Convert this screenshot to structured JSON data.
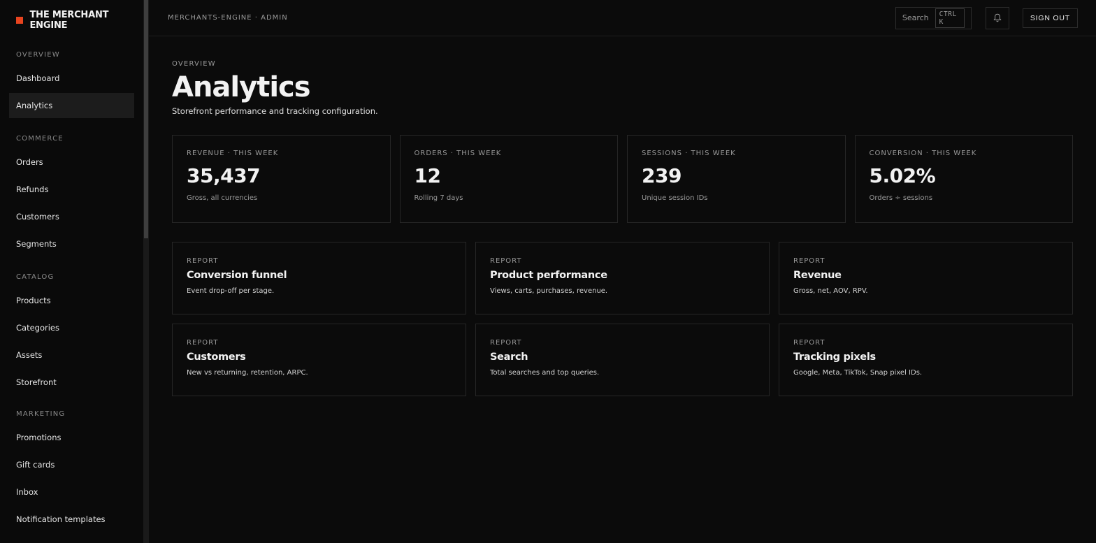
{
  "brand": {
    "name": "THE MERCHANT ENGINE",
    "accent": "#e8441f"
  },
  "sidebar": {
    "sections": [
      {
        "label": "OVERVIEW",
        "items": [
          "Dashboard",
          "Analytics"
        ]
      },
      {
        "label": "COMMERCE",
        "items": [
          "Orders",
          "Refunds",
          "Customers",
          "Segments"
        ]
      },
      {
        "label": "CATALOG",
        "items": [
          "Products",
          "Categories",
          "Assets",
          "Storefront"
        ]
      },
      {
        "label": "MARKETING",
        "items": [
          "Promotions",
          "Gift cards",
          "Inbox",
          "Notification templates"
        ]
      }
    ],
    "active_item": "Analytics"
  },
  "topbar": {
    "breadcrumb": "MERCHANTS-ENGINE · ADMIN",
    "search_label": "Search",
    "search_shortcut": "CTRL K",
    "bell_icon": "bell-icon",
    "signout_label": "SIGN OUT"
  },
  "page": {
    "eyebrow": "OVERVIEW",
    "title": "Analytics",
    "subtitle": "Storefront performance and tracking configuration."
  },
  "kpis": [
    {
      "label": "REVENUE · THIS WEEK",
      "value": "35,437",
      "sub": "Gross, all currencies"
    },
    {
      "label": "ORDERS · THIS WEEK",
      "value": "12",
      "sub": "Rolling 7 days"
    },
    {
      "label": "SESSIONS · THIS WEEK",
      "value": "239",
      "sub": "Unique session IDs"
    },
    {
      "label": "CONVERSION · THIS WEEK",
      "value": "5.02%",
      "sub": "Orders ÷ sessions"
    }
  ],
  "reports": [
    {
      "eyebrow": "REPORT",
      "title": "Conversion funnel",
      "desc": "Event drop-off per stage."
    },
    {
      "eyebrow": "REPORT",
      "title": "Product performance",
      "desc": "Views, carts, purchases, revenue."
    },
    {
      "eyebrow": "REPORT",
      "title": "Revenue",
      "desc": "Gross, net, AOV, RPV."
    },
    {
      "eyebrow": "REPORT",
      "title": "Customers",
      "desc": "New vs returning, retention, ARPC."
    },
    {
      "eyebrow": "REPORT",
      "title": "Search",
      "desc": "Total searches and top queries."
    },
    {
      "eyebrow": "REPORT",
      "title": "Tracking pixels",
      "desc": "Google, Meta, TikTok, Snap pixel IDs."
    }
  ]
}
